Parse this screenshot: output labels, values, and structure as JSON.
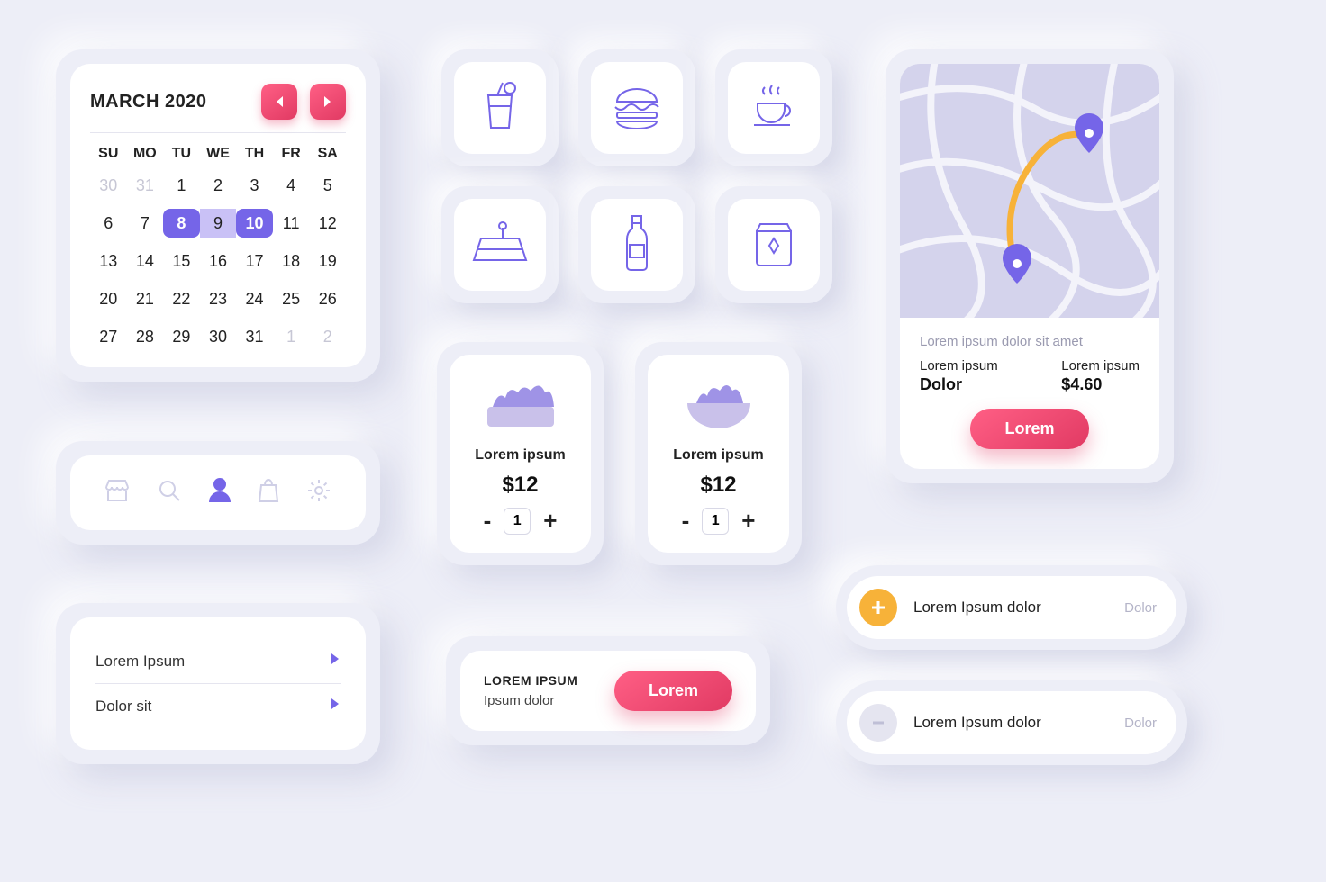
{
  "calendar": {
    "title": "MARCH 2020",
    "dow": [
      "SU",
      "MO",
      "TU",
      "WE",
      "TH",
      "FR",
      "SA"
    ],
    "days": [
      {
        "n": "30",
        "dim": true
      },
      {
        "n": "31",
        "dim": true
      },
      {
        "n": "1"
      },
      {
        "n": "2"
      },
      {
        "n": "3"
      },
      {
        "n": "4"
      },
      {
        "n": "5"
      },
      {
        "n": "6"
      },
      {
        "n": "7"
      },
      {
        "n": "8",
        "sel": "start"
      },
      {
        "n": "9",
        "sel": "mid"
      },
      {
        "n": "10",
        "sel": "end"
      },
      {
        "n": "11"
      },
      {
        "n": "12"
      },
      {
        "n": "13"
      },
      {
        "n": "14"
      },
      {
        "n": "15"
      },
      {
        "n": "16"
      },
      {
        "n": "17"
      },
      {
        "n": "18"
      },
      {
        "n": "19"
      },
      {
        "n": "20"
      },
      {
        "n": "21"
      },
      {
        "n": "22"
      },
      {
        "n": "23"
      },
      {
        "n": "24"
      },
      {
        "n": "25"
      },
      {
        "n": "26"
      },
      {
        "n": "27"
      },
      {
        "n": "28"
      },
      {
        "n": "29"
      },
      {
        "n": "30"
      },
      {
        "n": "31"
      },
      {
        "n": "1",
        "dim": true
      },
      {
        "n": "2",
        "dim": true
      }
    ]
  },
  "categories": [
    {
      "name": "drink-icon"
    },
    {
      "name": "burger-icon"
    },
    {
      "name": "coffee-icon"
    },
    {
      "name": "cake-icon"
    },
    {
      "name": "bottle-icon"
    },
    {
      "name": "bag-icon"
    }
  ],
  "map": {
    "subtitle": "Lorem ipsum dolor sit amet",
    "left_label": "Lorem ipsum",
    "left_value": "Dolor",
    "right_label": "Lorem ipsum",
    "right_value": "$4.60",
    "button": "Lorem"
  },
  "nav": {
    "items": [
      "store-icon",
      "search-icon",
      "user-icon",
      "bag-icon",
      "gear-icon"
    ],
    "active_index": 2
  },
  "products": [
    {
      "name": "Lorem ipsum",
      "price": "$12",
      "qty": "1"
    },
    {
      "name": "Lorem ipsum",
      "price": "$12",
      "qty": "1"
    }
  ],
  "list": {
    "items": [
      "Lorem Ipsum",
      "Dolor sit"
    ]
  },
  "toast": {
    "title": "LOREM IPSUM",
    "sub": "Ipsum dolor",
    "button": "Lorem"
  },
  "actions": [
    {
      "icon": "add",
      "label": "Lorem Ipsum dolor",
      "right": "Dolor"
    },
    {
      "icon": "sub",
      "label": "Lorem Ipsum dolor",
      "right": "Dolor"
    }
  ]
}
